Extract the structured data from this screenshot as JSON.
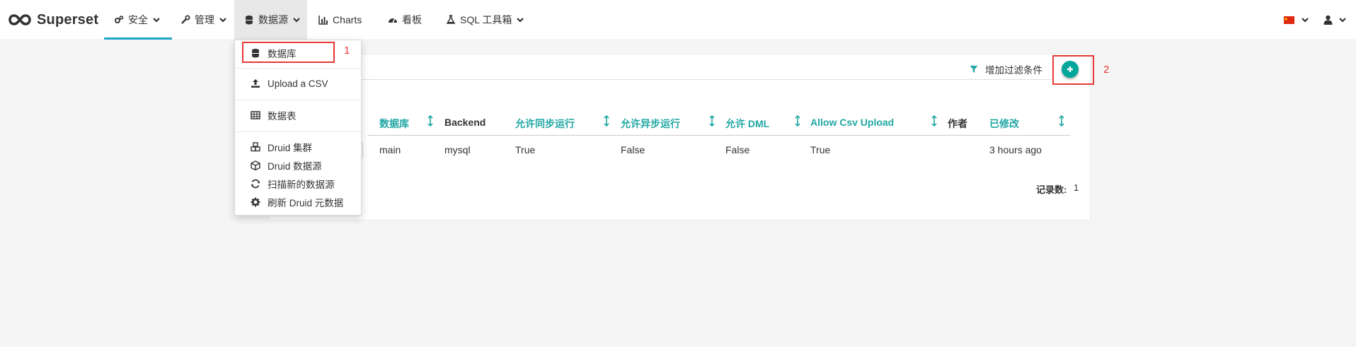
{
  "app": {
    "brand": "Superset"
  },
  "nav": {
    "security": "安全",
    "manage": "管理",
    "sources": "数据源",
    "charts": "Charts",
    "dashboards": "看板",
    "sql_lab": "SQL 工具箱"
  },
  "dropdown": {
    "databases": "数据库",
    "upload_csv": "Upload a CSV",
    "tables": "数据表",
    "druid_clusters": "Druid 集群",
    "druid_datasources": "Druid 数据源",
    "scan_new": "扫描新的数据源",
    "refresh_druid": "刷新 Druid 元数据"
  },
  "annotations": {
    "one": "1",
    "two": "2"
  },
  "toolbar": {
    "add_filter": "增加过滤条件"
  },
  "table": {
    "headers": [
      "数据库",
      "Backend",
      "允许同步运行",
      "允许异步运行",
      "允许 DML",
      "Allow Csv Upload",
      "作者",
      "已修改"
    ],
    "rows": [
      [
        "main",
        "mysql",
        "True",
        "False",
        "False",
        "True",
        "",
        "3 hours ago"
      ]
    ]
  },
  "footer": {
    "record_count_label": "记录数:",
    "record_count": "1"
  },
  "colors": {
    "accent": "#20a7a4",
    "add_button": "#00a699",
    "highlight": "#e53935"
  },
  "icons": [
    "superset-logo",
    "cogs-icon",
    "wrench-icon",
    "database-icon",
    "bar-chart-icon",
    "dashboard-icon",
    "flask-icon",
    "flag-icon",
    "user-icon",
    "upload-icon",
    "table-icon",
    "cubes-icon",
    "cube-icon",
    "refresh-icon",
    "cog-icon",
    "filter-icon",
    "plus-icon",
    "sort-icon"
  ]
}
